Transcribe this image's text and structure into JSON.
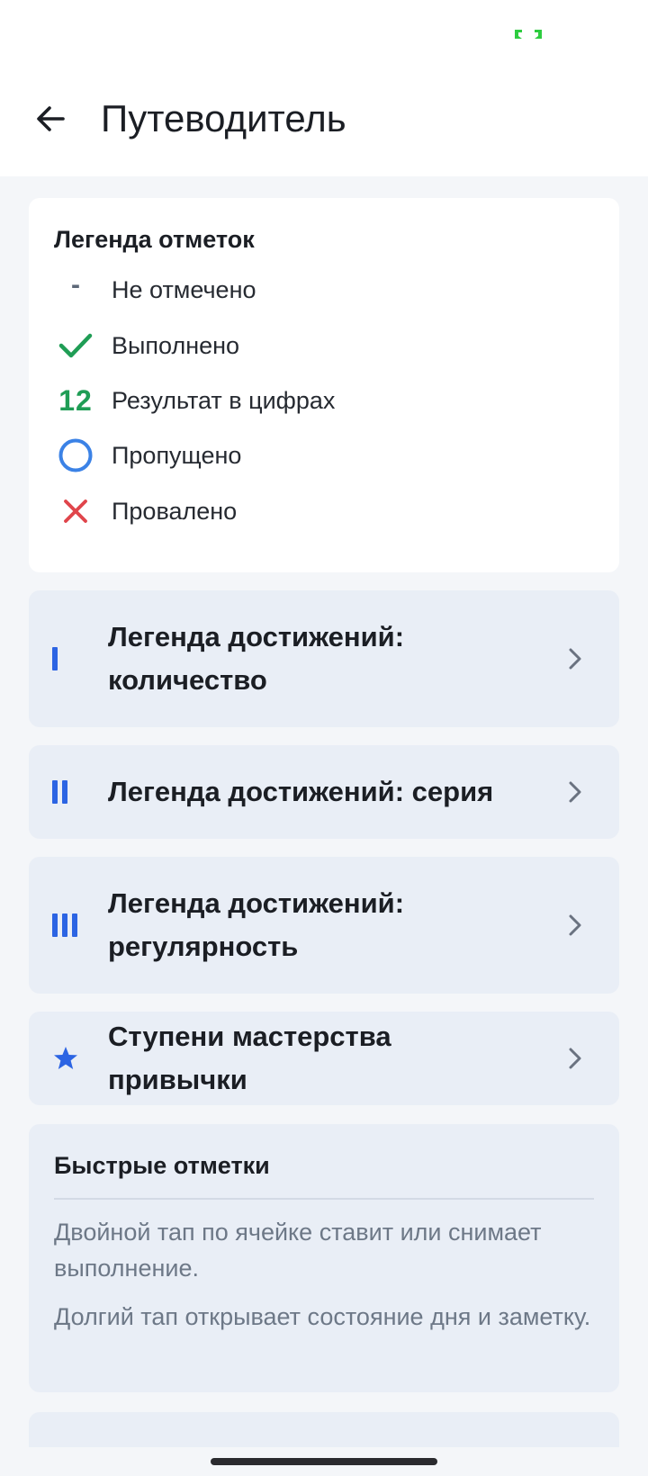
{
  "app_bar": {
    "title": "Путеводитель"
  },
  "legend": {
    "heading": "Легенда отметок",
    "items": [
      {
        "icon": "dash-icon",
        "glyph": "-",
        "label": "Не отмечено"
      },
      {
        "icon": "check-icon",
        "label": "Выполнено"
      },
      {
        "icon": "number-icon",
        "glyph": "12",
        "label": "Результат в цифрах"
      },
      {
        "icon": "circle-icon",
        "label": "Пропущено"
      },
      {
        "icon": "cross-icon",
        "label": "Провалено"
      }
    ]
  },
  "nav_cards": [
    {
      "icon": "roman-one-icon",
      "label": "Легенда достижений: количество"
    },
    {
      "icon": "roman-two-icon",
      "label": "Легенда достижений: серия"
    },
    {
      "icon": "roman-three-icon",
      "label": "Легенда достижений: регулярность"
    },
    {
      "icon": "star-icon",
      "label": "Ступени мастерства привычки"
    }
  ],
  "tips": {
    "heading": "Быстрые отметки",
    "lines": [
      "Двойной тап по ячейке ставит или снимает выполнение.",
      "Долгий тап открывает состояние дня и заметку."
    ]
  },
  "colors": {
    "accent": "#2c64e3",
    "done": "#1f9d55",
    "skipped": "#3b82e6",
    "failed": "#e0454b",
    "card": "#e9eef6"
  }
}
